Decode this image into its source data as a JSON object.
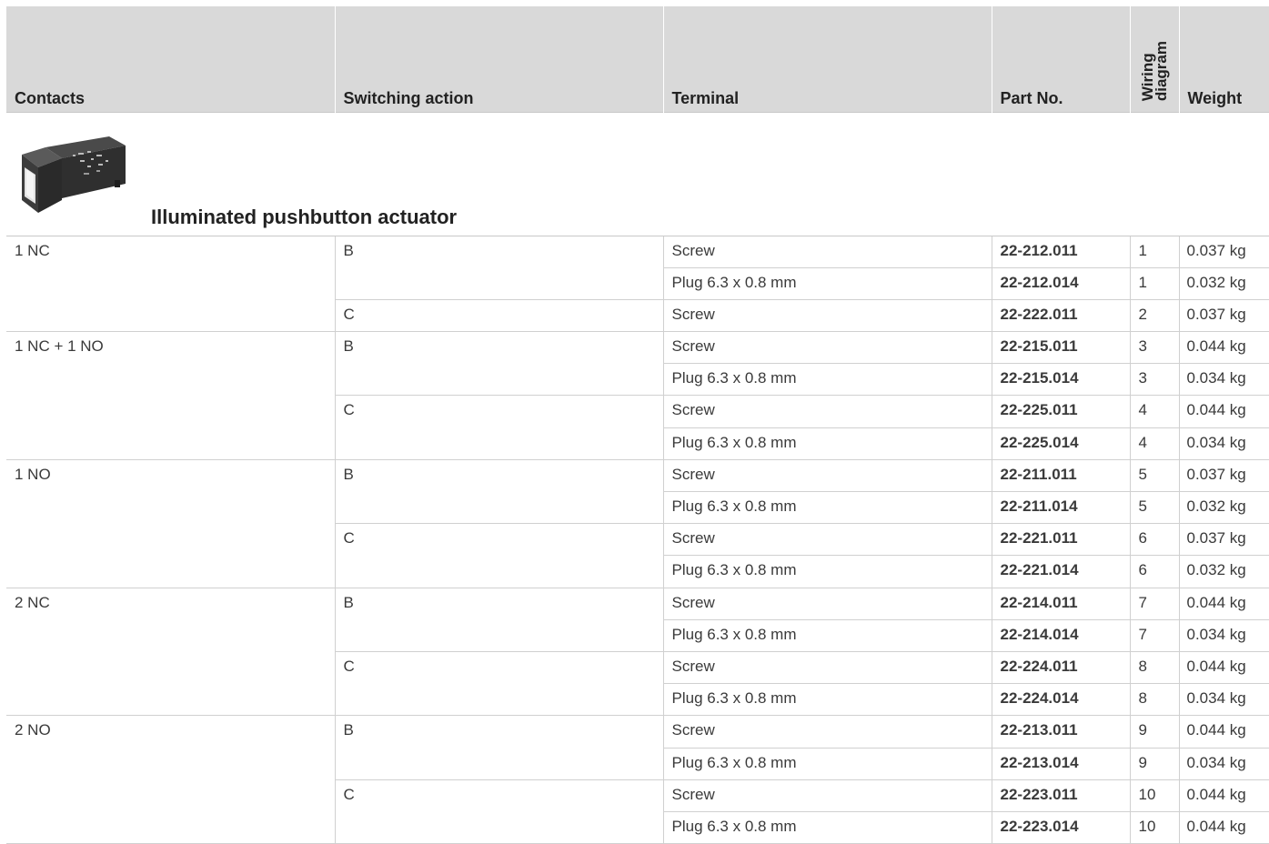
{
  "headers": {
    "contacts": "Contacts",
    "switching_action": "Switching action",
    "terminal": "Terminal",
    "part_no": "Part No.",
    "wiring_line1": "Wiring",
    "wiring_line2": "diagram",
    "weight": "Weight"
  },
  "section": {
    "title": "Illuminated pushbutton actuator",
    "image_icon": "pushbutton-switch-product-image"
  },
  "rows": [
    {
      "contacts": "1 NC",
      "switching": "B",
      "terminal": "Screw",
      "part_no": "22-212.011",
      "wiring": "1",
      "weight": "0.037 kg"
    },
    {
      "contacts": "",
      "switching": "",
      "terminal": "Plug 6.3 x 0.8 mm",
      "part_no": "22-212.014",
      "wiring": "1",
      "weight": "0.032 kg"
    },
    {
      "contacts": "",
      "switching": "C",
      "terminal": "Screw",
      "part_no": "22-222.011",
      "wiring": "2",
      "weight": "0.037 kg"
    },
    {
      "contacts": "1 NC + 1 NO",
      "switching": "B",
      "terminal": "Screw",
      "part_no": "22-215.011",
      "wiring": "3",
      "weight": "0.044 kg"
    },
    {
      "contacts": "",
      "switching": "",
      "terminal": "Plug 6.3 x 0.8 mm",
      "part_no": "22-215.014",
      "wiring": "3",
      "weight": "0.034 kg"
    },
    {
      "contacts": "",
      "switching": "C",
      "terminal": "Screw",
      "part_no": "22-225.011",
      "wiring": "4",
      "weight": "0.044 kg"
    },
    {
      "contacts": "",
      "switching": "",
      "terminal": "Plug 6.3 x 0.8 mm",
      "part_no": "22-225.014",
      "wiring": "4",
      "weight": "0.034 kg"
    },
    {
      "contacts": "1 NO",
      "switching": "B",
      "terminal": "Screw",
      "part_no": "22-211.011",
      "wiring": "5",
      "weight": "0.037 kg"
    },
    {
      "contacts": "",
      "switching": "",
      "terminal": "Plug 6.3 x 0.8 mm",
      "part_no": "22-211.014",
      "wiring": "5",
      "weight": "0.032 kg"
    },
    {
      "contacts": "",
      "switching": "C",
      "terminal": "Screw",
      "part_no": "22-221.011",
      "wiring": "6",
      "weight": "0.037 kg"
    },
    {
      "contacts": "",
      "switching": "",
      "terminal": "Plug 6.3 x 0.8 mm",
      "part_no": "22-221.014",
      "wiring": "6",
      "weight": "0.032 kg"
    },
    {
      "contacts": "2 NC",
      "switching": "B",
      "terminal": "Screw",
      "part_no": "22-214.011",
      "wiring": "7",
      "weight": "0.044 kg"
    },
    {
      "contacts": "",
      "switching": "",
      "terminal": "Plug 6.3 x 0.8 mm",
      "part_no": "22-214.014",
      "wiring": "7",
      "weight": "0.034 kg"
    },
    {
      "contacts": "",
      "switching": "C",
      "terminal": "Screw",
      "part_no": "22-224.011",
      "wiring": "8",
      "weight": "0.044 kg"
    },
    {
      "contacts": "",
      "switching": "",
      "terminal": "Plug 6.3 x 0.8 mm",
      "part_no": "22-224.014",
      "wiring": "8",
      "weight": "0.034 kg"
    },
    {
      "contacts": "2 NO",
      "switching": "B",
      "terminal": "Screw",
      "part_no": "22-213.011",
      "wiring": "9",
      "weight": "0.044 kg"
    },
    {
      "contacts": "",
      "switching": "",
      "terminal": "Plug 6.3 x 0.8 mm",
      "part_no": "22-213.014",
      "wiring": "9",
      "weight": "0.034 kg"
    },
    {
      "contacts": "",
      "switching": "C",
      "terminal": "Screw",
      "part_no": "22-223.011",
      "wiring": "10",
      "weight": "0.044 kg"
    },
    {
      "contacts": "",
      "switching": "",
      "terminal": "Plug 6.3 x 0.8 mm",
      "part_no": "22-223.014",
      "wiring": "10",
      "weight": "0.044 kg"
    }
  ]
}
